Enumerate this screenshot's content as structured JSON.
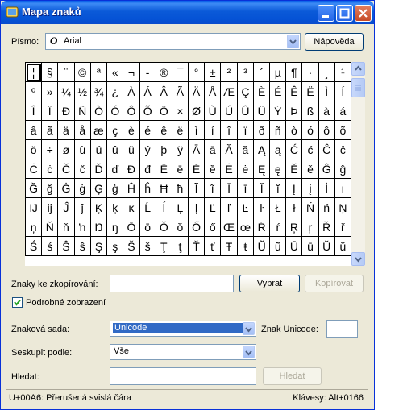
{
  "window": {
    "title": "Mapa znaků"
  },
  "font": {
    "label": "Písmo:",
    "value": "Arial",
    "icon": "opentype-icon"
  },
  "help_button": "Nápověda",
  "chars": [
    [
      "¦",
      "§",
      "¨",
      "©",
      "ª",
      "«",
      "¬",
      "-",
      "®",
      "¯",
      "°",
      "±",
      "²",
      "³",
      "´",
      "µ",
      "¶",
      "·",
      "¸",
      "¹"
    ],
    [
      "º",
      "»",
      "¼",
      "½",
      "¾",
      "¿",
      "À",
      "Á",
      "Â",
      "Ã",
      "Ä",
      "Å",
      "Æ",
      "Ç",
      "È",
      "É",
      "Ê",
      "Ë",
      "Ì",
      "Í"
    ],
    [
      "Î",
      "Ï",
      "Ð",
      "Ñ",
      "Ò",
      "Ó",
      "Ô",
      "Õ",
      "Ö",
      "×",
      "Ø",
      "Ù",
      "Ú",
      "Û",
      "Ü",
      "Ý",
      "Þ",
      "ß",
      "à",
      "á"
    ],
    [
      "â",
      "ã",
      "ä",
      "å",
      "æ",
      "ç",
      "è",
      "é",
      "ê",
      "ë",
      "ì",
      "í",
      "î",
      "ï",
      "ð",
      "ñ",
      "ò",
      "ó",
      "ô",
      "õ"
    ],
    [
      "ö",
      "÷",
      "ø",
      "ù",
      "ú",
      "û",
      "ü",
      "ý",
      "þ",
      "ÿ",
      "Ā",
      "ā",
      "Ă",
      "ă",
      "Ą",
      "ą",
      "Ć",
      "ć",
      "Ĉ",
      "ĉ"
    ],
    [
      "Ċ",
      "ċ",
      "Č",
      "č",
      "Ď",
      "ď",
      "Đ",
      "đ",
      "Ē",
      "ē",
      "Ĕ",
      "ĕ",
      "Ė",
      "ė",
      "Ę",
      "ę",
      "Ě",
      "ě",
      "Ĝ",
      "ĝ"
    ],
    [
      "Ğ",
      "ğ",
      "Ġ",
      "ġ",
      "Ģ",
      "ģ",
      "Ĥ",
      "ĥ",
      "Ħ",
      "ħ",
      "Ĩ",
      "ĩ",
      "Ī",
      "ī",
      "Ĭ",
      "ĭ",
      "Į",
      "į",
      "İ",
      "ı"
    ],
    [
      "Ĳ",
      "ĳ",
      "Ĵ",
      "ĵ",
      "Ķ",
      "ķ",
      "ĸ",
      "Ĺ",
      "ĺ",
      "Ļ",
      "ļ",
      "Ľ",
      "ľ",
      "Ŀ",
      "ŀ",
      "Ł",
      "ł",
      "Ń",
      "ń",
      "Ņ"
    ],
    [
      "ņ",
      "Ň",
      "ň",
      "ŉ",
      "Ŋ",
      "ŋ",
      "Ō",
      "ō",
      "Ŏ",
      "ŏ",
      "Ő",
      "ő",
      "Œ",
      "œ",
      "Ŕ",
      "ŕ",
      "Ŗ",
      "ŗ",
      "Ř",
      "ř"
    ],
    [
      "Ś",
      "ś",
      "Ŝ",
      "ŝ",
      "Ş",
      "ş",
      "Š",
      "š",
      "Ţ",
      "ţ",
      "Ť",
      "ť",
      "Ŧ",
      "ŧ",
      "Ũ",
      "ũ",
      "Ū",
      "ū",
      "Ŭ",
      "ŭ"
    ]
  ],
  "copy": {
    "label": "Znaky ke zkopírování:",
    "value": "",
    "select_button": "Vybrat",
    "copy_button": "Kopírovat"
  },
  "advanced_view": {
    "label": "Podrobné zobrazení",
    "checked": true
  },
  "charset": {
    "label": "Znaková sada:",
    "value": "Unicode"
  },
  "unicode_goto": {
    "label": "Znak Unicode:",
    "value": ""
  },
  "group_by": {
    "label": "Seskupit podle:",
    "value": "Vše"
  },
  "search": {
    "label": "Hledat:",
    "value": "",
    "button": "Hledat"
  },
  "status": {
    "left": "U+00A6: Přerušená svislá čára",
    "right": "Klávesy: Alt+0166"
  },
  "colors": {
    "title_bar": "#0a5fe8",
    "window_bg": "#ece9d8",
    "selection": "#316ac5"
  }
}
